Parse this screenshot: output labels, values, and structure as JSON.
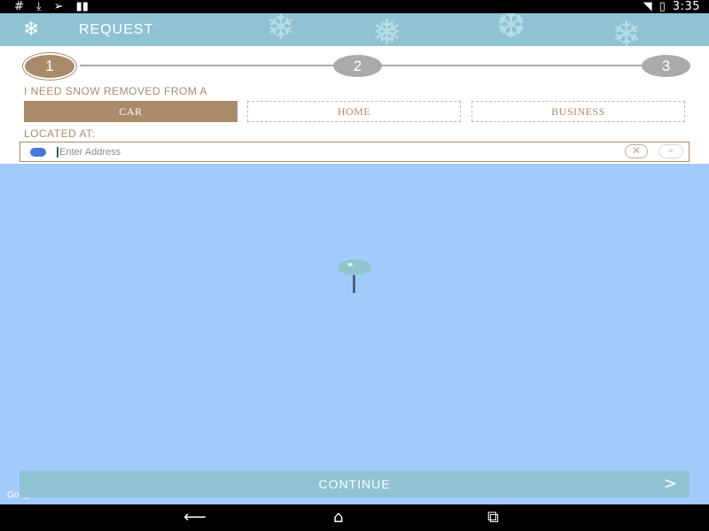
{
  "status_bar": {
    "left_icons": [
      "hash-icon",
      "download-icon",
      "send-icon",
      "signal-bars-icon"
    ],
    "right_icons": [
      "wifi-icon",
      "battery-charging-icon"
    ],
    "time": "3:35"
  },
  "app_bar": {
    "icon": "snowflake-icon",
    "title": "REQUEST"
  },
  "progress": {
    "steps": [
      "1",
      "2",
      "3"
    ],
    "current_step": 1
  },
  "form": {
    "removal_label": "I NEED SNOW REMOVED FROM A",
    "options": [
      "CAR",
      "HOME",
      "BUSINESS"
    ],
    "selected_option": "CAR",
    "location_label": "LOCATED AT:",
    "address_placeholder": "Enter Address",
    "address_value": ""
  },
  "actions": {
    "continue_label": "CONTINUE"
  },
  "colors": {
    "accent": "#a98b6c",
    "header": "#8fc3d3",
    "map": "#a2cbfb",
    "inactive_step": "#aaaaaa"
  }
}
